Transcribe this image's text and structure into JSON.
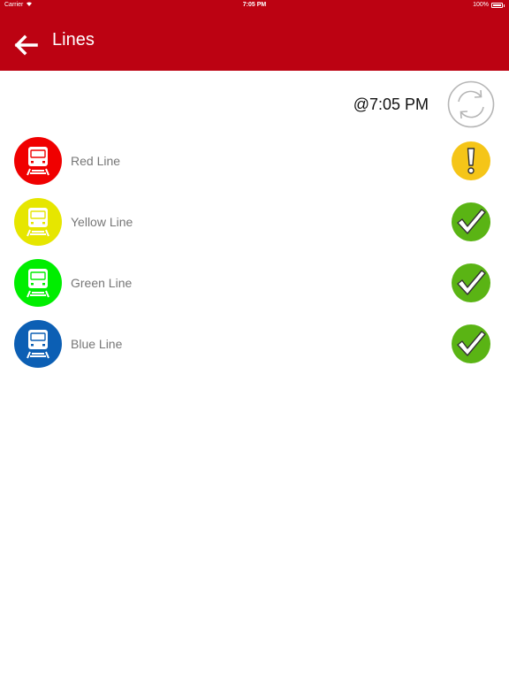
{
  "status_bar": {
    "carrier": "Carrier",
    "time": "7:05 PM",
    "battery": "100%"
  },
  "header": {
    "title": "Lines",
    "background": "#bc0212"
  },
  "refresh": {
    "timestamp": "@7:05 PM"
  },
  "lines": [
    {
      "name": "Red Line",
      "color": "#f00000",
      "status": "alert",
      "status_color": "#f5c518"
    },
    {
      "name": "Yellow Line",
      "color": "#e6e600",
      "status": "ok",
      "status_color": "#5ab414"
    },
    {
      "name": "Green Line",
      "color": "#00ee00",
      "status": "ok",
      "status_color": "#5ab414"
    },
    {
      "name": "Blue Line",
      "color": "#0c5fb4",
      "status": "ok",
      "status_color": "#5ab414"
    }
  ]
}
